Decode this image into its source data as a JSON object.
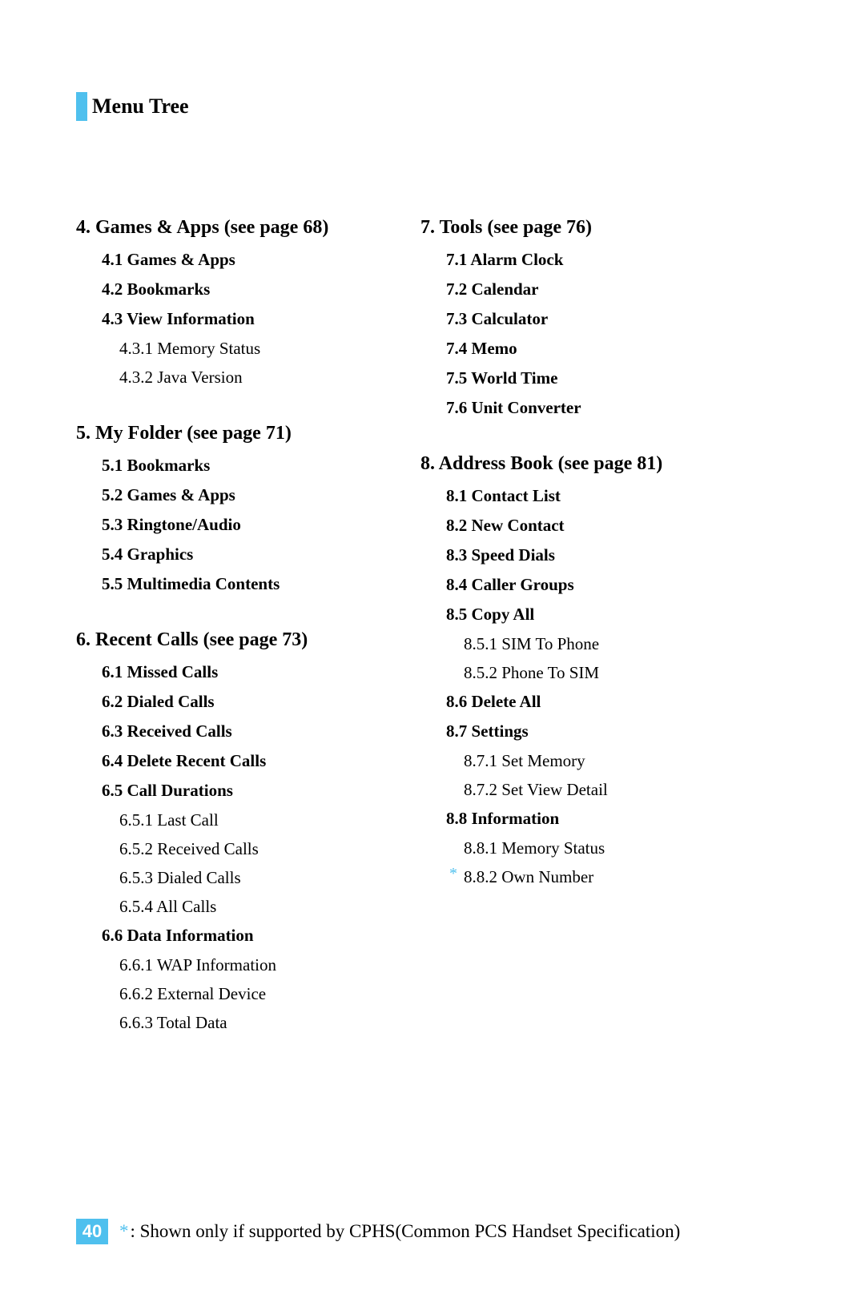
{
  "header": {
    "title": "Menu Tree"
  },
  "left": [
    {
      "title": "4.  Games & Apps (see page 68)",
      "items": [
        {
          "text": "4.1 Games & Apps",
          "bold": true
        },
        {
          "text": "4.2 Bookmarks",
          "bold": true
        },
        {
          "text": "4.3 View Information",
          "bold": true
        },
        {
          "text": "4.3.1 Memory Status",
          "bold": false
        },
        {
          "text": "4.3.2 Java Version",
          "bold": false
        }
      ]
    },
    {
      "title": "5.  My Folder (see page 71)",
      "items": [
        {
          "text": "5.1 Bookmarks",
          "bold": true
        },
        {
          "text": "5.2 Games & Apps",
          "bold": true
        },
        {
          "text": "5.3 Ringtone/Audio",
          "bold": true
        },
        {
          "text": "5.4 Graphics",
          "bold": true
        },
        {
          "text": "5.5 Multimedia Contents",
          "bold": true
        }
      ]
    },
    {
      "title": "6.  Recent Calls (see page 73)",
      "items": [
        {
          "text": "6.1 Missed Calls",
          "bold": true
        },
        {
          "text": "6.2 Dialed Calls",
          "bold": true
        },
        {
          "text": "6.3 Received Calls",
          "bold": true
        },
        {
          "text": "6.4 Delete Recent Calls",
          "bold": true
        },
        {
          "text": "6.5 Call Durations",
          "bold": true
        },
        {
          "text": "6.5.1 Last Call",
          "bold": false
        },
        {
          "text": "6.5.2 Received Calls",
          "bold": false
        },
        {
          "text": "6.5.3 Dialed Calls",
          "bold": false
        },
        {
          "text": "6.5.4 All Calls",
          "bold": false
        },
        {
          "text": "6.6 Data Information",
          "bold": true
        },
        {
          "text": "6.6.1 WAP Information",
          "bold": false
        },
        {
          "text": "6.6.2 External Device",
          "bold": false
        },
        {
          "text": "6.6.3 Total Data",
          "bold": false
        }
      ]
    }
  ],
  "right": [
    {
      "title": "7.  Tools (see page 76)",
      "items": [
        {
          "text": "7.1 Alarm Clock",
          "bold": true
        },
        {
          "text": "7.2 Calendar",
          "bold": true
        },
        {
          "text": "7.3 Calculator",
          "bold": true
        },
        {
          "text": "7.4  Memo",
          "bold": true
        },
        {
          "text": "7.5 World Time",
          "bold": true
        },
        {
          "text": "7.6 Unit Converter",
          "bold": true
        }
      ]
    },
    {
      "title": "8.  Address Book (see page 81)",
      "items": [
        {
          "text": "8.1 Contact List",
          "bold": true
        },
        {
          "text": "8.2 New Contact",
          "bold": true
        },
        {
          "text": "8.3 Speed Dials",
          "bold": true
        },
        {
          "text": "8.4 Caller Groups",
          "bold": true
        },
        {
          "text": "8.5 Copy All",
          "bold": true
        },
        {
          "text": "8.5.1 SIM To Phone",
          "bold": false
        },
        {
          "text": "8.5.2 Phone To SIM",
          "bold": false
        },
        {
          "text": "8.6 Delete All",
          "bold": true
        },
        {
          "text": "8.7 Settings",
          "bold": true
        },
        {
          "text": "8.7.1 Set Memory",
          "bold": false
        },
        {
          "text": "8.7.2 Set View Detail",
          "bold": false
        },
        {
          "text": "8.8 Information",
          "bold": true
        },
        {
          "text": "8.8.1 Memory Status",
          "bold": false
        },
        {
          "text": "8.8.2 Own Number",
          "bold": false,
          "asterisk": true
        }
      ]
    }
  ],
  "footer": {
    "page": "40",
    "asterisk": "*",
    "text": ": Shown only if supported by CPHS(Common PCS Handset Specification)"
  }
}
